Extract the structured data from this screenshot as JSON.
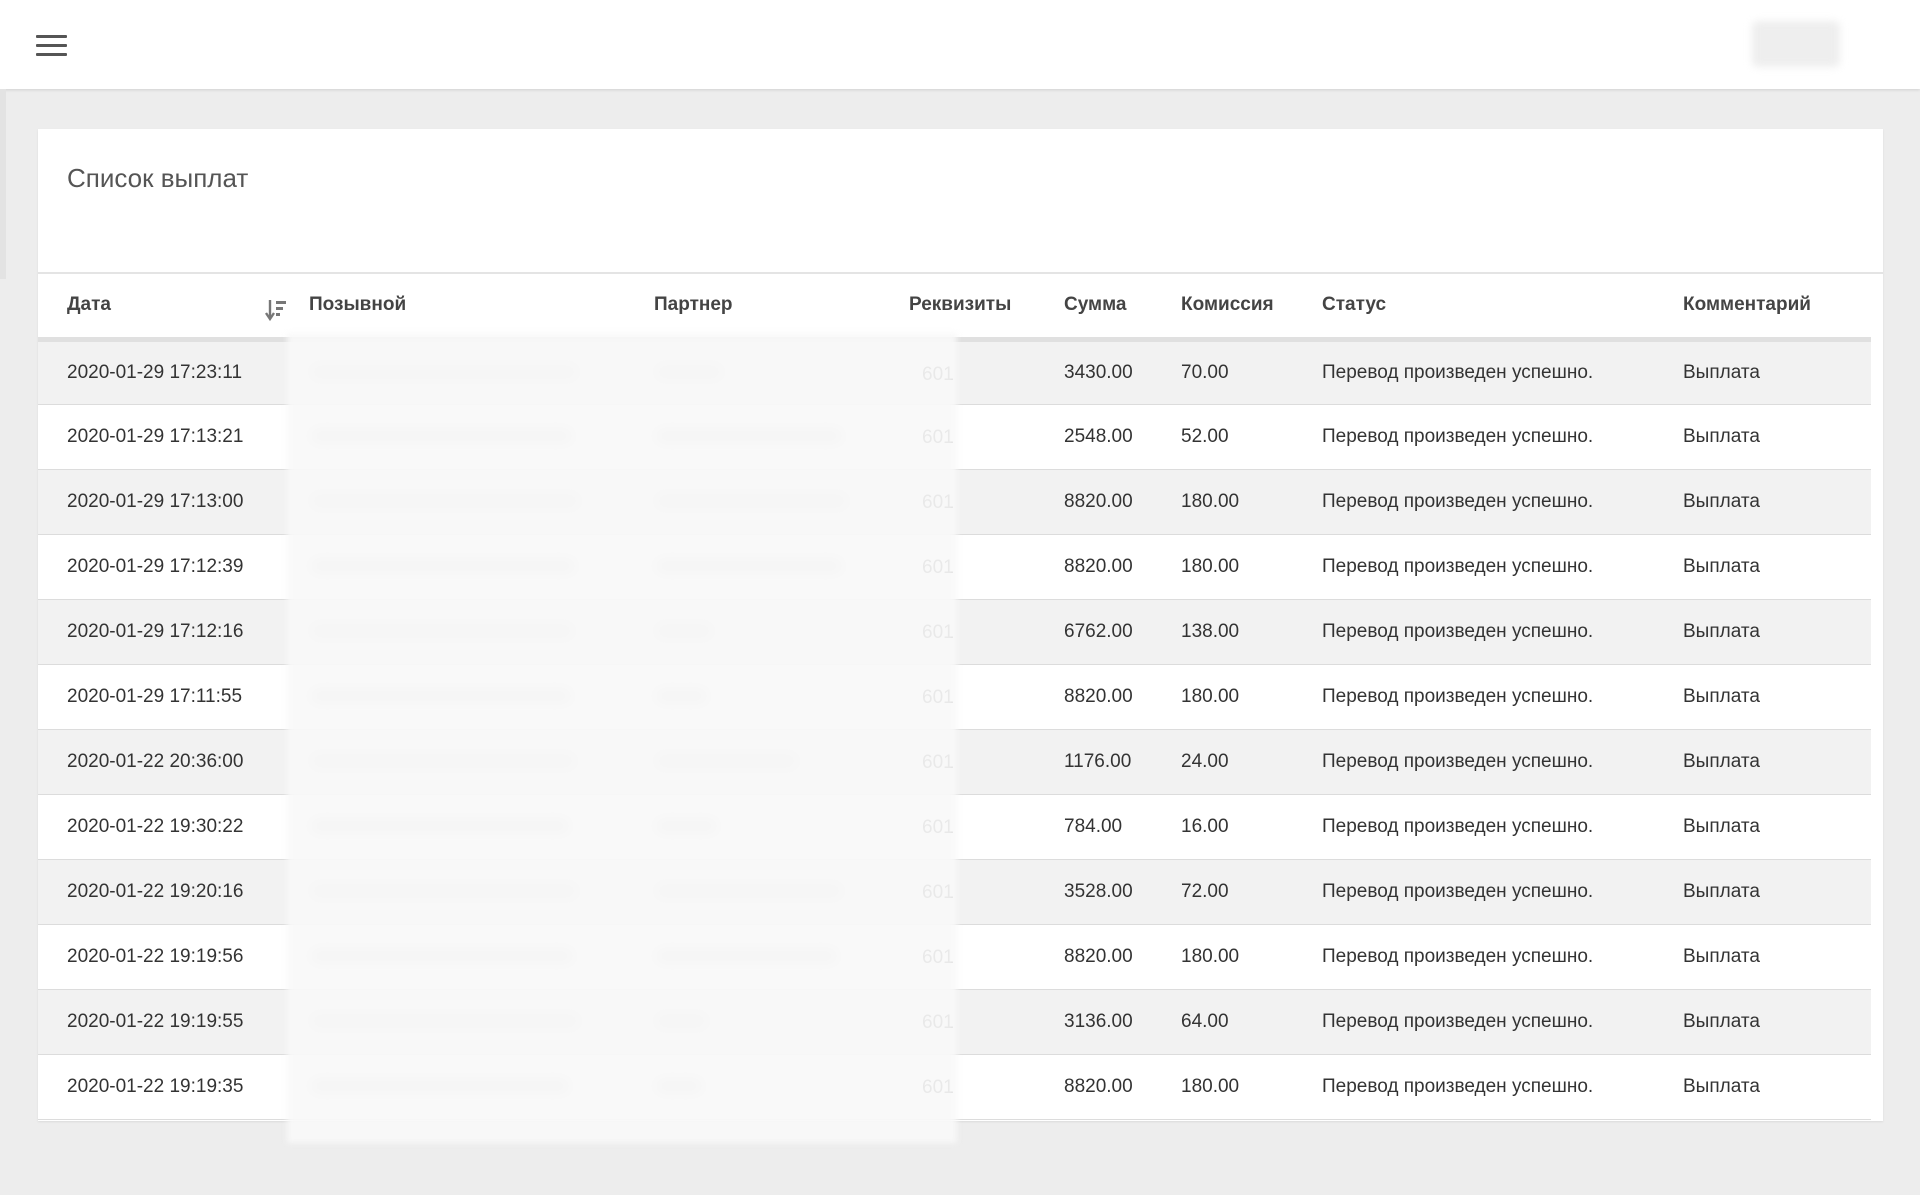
{
  "header": {
    "menu_icon": "hamburger-menu-icon"
  },
  "card": {
    "title": "Список выплат"
  },
  "table": {
    "columns": [
      "Дата",
      "Позывной",
      "Партнер",
      "Реквизиты",
      "Сумма",
      "Комиссия",
      "Статус",
      "Комментарий"
    ],
    "sort_icon": "sort-descending-icon",
    "rows": [
      {
        "date": "2020-01-29 17:23:11",
        "requisites": "601",
        "amount": "3430.00",
        "fee": "70.00",
        "status": "Перевод произведен успешно.",
        "comment": "Выплата"
      },
      {
        "date": "2020-01-29 17:13:21",
        "requisites": "601",
        "amount": "2548.00",
        "fee": "52.00",
        "status": "Перевод произведен успешно.",
        "comment": "Выплата"
      },
      {
        "date": "2020-01-29 17:13:00",
        "requisites": "601",
        "amount": "8820.00",
        "fee": "180.00",
        "status": "Перевод произведен успешно.",
        "comment": "Выплата"
      },
      {
        "date": "2020-01-29 17:12:39",
        "requisites": "601",
        "amount": "8820.00",
        "fee": "180.00",
        "status": "Перевод произведен успешно.",
        "comment": "Выплата"
      },
      {
        "date": "2020-01-29 17:12:16",
        "requisites": "601",
        "amount": "6762.00",
        "fee": "138.00",
        "status": "Перевод произведен успешно.",
        "comment": "Выплата"
      },
      {
        "date": "2020-01-29 17:11:55",
        "requisites": "601",
        "amount": "8820.00",
        "fee": "180.00",
        "status": "Перевод произведен успешно.",
        "comment": "Выплата"
      },
      {
        "date": "2020-01-22 20:36:00",
        "requisites": "601",
        "amount": "1176.00",
        "fee": "24.00",
        "status": "Перевод произведен успешно.",
        "comment": "Выплата"
      },
      {
        "date": "2020-01-22 19:30:22",
        "requisites": "601",
        "amount": "784.00",
        "fee": "16.00",
        "status": "Перевод произведен успешно.",
        "comment": "Выплата"
      },
      {
        "date": "2020-01-22 19:20:16",
        "requisites": "601",
        "amount": "3528.00",
        "fee": "72.00",
        "status": "Перевод произведен успешно.",
        "comment": "Выплата"
      },
      {
        "date": "2020-01-22 19:19:56",
        "requisites": "601",
        "amount": "8820.00",
        "fee": "180.00",
        "status": "Перевод произведен успешно.",
        "comment": "Выплата"
      },
      {
        "date": "2020-01-22 19:19:55",
        "requisites": "601",
        "amount": "3136.00",
        "fee": "64.00",
        "status": "Перевод произведен успешно.",
        "comment": "Выплата"
      },
      {
        "date": "2020-01-22 19:19:35",
        "requisites": "601",
        "amount": "8820.00",
        "fee": "180.00",
        "status": "Перевод произведен успешно.",
        "comment": "Выплата"
      }
    ]
  }
}
